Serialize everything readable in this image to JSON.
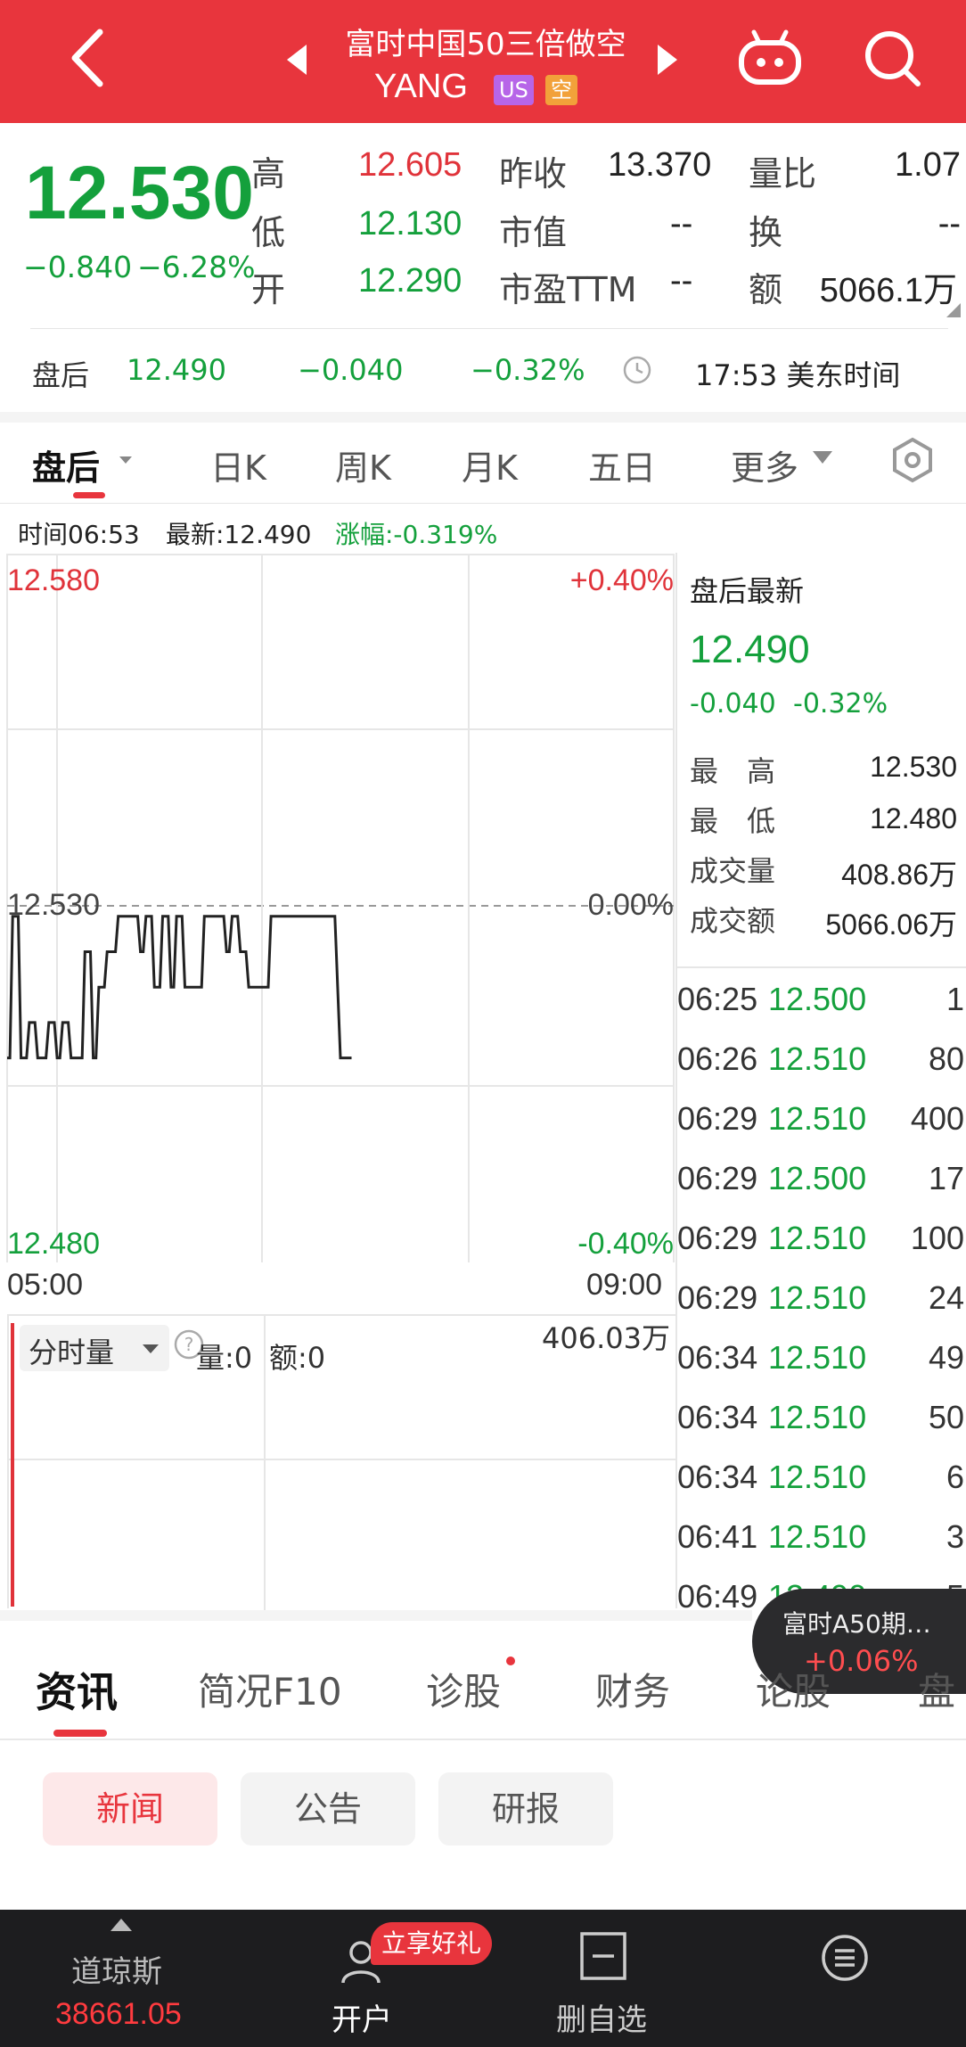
{
  "header": {
    "title": "富时中国50三倍做空",
    "code": "YANG",
    "market_badge": "US",
    "type_badge": "空"
  },
  "quote": {
    "price": "12.530",
    "change": "−0.840",
    "change_pct": "−6.28%",
    "high_label": "高",
    "high": "12.605",
    "low_label": "低",
    "low": "12.130",
    "open_label": "开",
    "open": "12.290",
    "prev_close_label": "昨收",
    "prev_close": "13.370",
    "market_cap_label": "市值",
    "market_cap": "--",
    "pe_label": "市盈TTM",
    "pe": "--",
    "volume_ratio_label": "量比",
    "volume_ratio": "1.07",
    "turnover_label": "换",
    "turnover": "--",
    "amount_label": "额",
    "amount": "5066.1万"
  },
  "after_hours": {
    "label": "盘后",
    "price": "12.490",
    "change": "−0.040",
    "change_pct": "−0.32%",
    "time": "17:53 美东时间"
  },
  "chart_tabs": [
    {
      "label": "盘后"
    },
    {
      "label": "日K"
    },
    {
      "label": "周K"
    },
    {
      "label": "月K"
    },
    {
      "label": "五日"
    },
    {
      "label": "更多"
    }
  ],
  "crosshair": {
    "time": "时间06:53",
    "latest": "最新:12.490",
    "change": "涨幅:-0.319%"
  },
  "chart_axes": {
    "top_price": "12.580",
    "mid_price": "12.530",
    "bottom_price": "12.480",
    "top_pct": "+0.40%",
    "mid_pct": "0.00%",
    "bottom_pct": "-0.40%",
    "x_start": "05:00",
    "x_end": "09:00"
  },
  "side_panel": {
    "title": "盘后最新",
    "price": "12.490",
    "change": "-0.040",
    "change_pct": "-0.32%",
    "high_label": "最　高",
    "high": "12.530",
    "low_label": "最　低",
    "low": "12.480",
    "volume_label": "成交量",
    "volume": "408.86万",
    "amount_label": "成交额",
    "amount": "5066.06万"
  },
  "trades": [
    {
      "time": "06:25",
      "price": "12.500",
      "vol": "1"
    },
    {
      "time": "06:26",
      "price": "12.510",
      "vol": "80"
    },
    {
      "time": "06:29",
      "price": "12.510",
      "vol": "400"
    },
    {
      "time": "06:29",
      "price": "12.500",
      "vol": "17"
    },
    {
      "time": "06:29",
      "price": "12.510",
      "vol": "100"
    },
    {
      "time": "06:29",
      "price": "12.510",
      "vol": "24"
    },
    {
      "time": "06:34",
      "price": "12.510",
      "vol": "49"
    },
    {
      "time": "06:34",
      "price": "12.510",
      "vol": "50"
    },
    {
      "time": "06:34",
      "price": "12.510",
      "vol": "6"
    },
    {
      "time": "06:41",
      "price": "12.510",
      "vol": "3"
    },
    {
      "time": "06:49",
      "price": "12.490",
      "vol": "5"
    }
  ],
  "volume_panel": {
    "selector": "分时量",
    "vol": "量:0",
    "amount": "额:0",
    "max": "406.03万"
  },
  "float_widget": {
    "name": "富时A50期…",
    "change": "+0.06%"
  },
  "content_tabs": [
    {
      "label": "资讯"
    },
    {
      "label": "简况F10"
    },
    {
      "label": "诊股"
    },
    {
      "label": "财务"
    },
    {
      "label": "论股"
    },
    {
      "label": "盘"
    }
  ],
  "segments": [
    {
      "label": "新闻"
    },
    {
      "label": "公告"
    },
    {
      "label": "研报"
    }
  ],
  "bottom_bar": {
    "index_name": "道琼斯",
    "index_value": "38661.05",
    "open_account": "开户",
    "promo": "立享好礼",
    "remove_watch": "删自选"
  },
  "price_series": {
    "ylim": [
      12.48,
      12.58
    ],
    "xlim": [
      0,
      240
    ],
    "points": [
      [
        0,
        12.49
      ],
      [
        1,
        12.49
      ],
      [
        2,
        12.51
      ],
      [
        4,
        12.51
      ],
      [
        5,
        12.49
      ],
      [
        7,
        12.49
      ],
      [
        8,
        12.495
      ],
      [
        10,
        12.495
      ],
      [
        11,
        12.49
      ],
      [
        14,
        12.49
      ],
      [
        15,
        12.495
      ],
      [
        17,
        12.495
      ],
      [
        18,
        12.49
      ],
      [
        19,
        12.49
      ],
      [
        20,
        12.495
      ],
      [
        22,
        12.495
      ],
      [
        23,
        12.49
      ],
      [
        27,
        12.49
      ],
      [
        28,
        12.505
      ],
      [
        30,
        12.505
      ],
      [
        31,
        12.49
      ],
      [
        32,
        12.49
      ],
      [
        33,
        12.5
      ],
      [
        35,
        12.5
      ],
      [
        36,
        12.505
      ],
      [
        39,
        12.505
      ],
      [
        40,
        12.51
      ],
      [
        47,
        12.51
      ],
      [
        48,
        12.505
      ],
      [
        49,
        12.505
      ],
      [
        50,
        12.51
      ],
      [
        52,
        12.51
      ],
      [
        53,
        12.5
      ],
      [
        55,
        12.5
      ],
      [
        56,
        12.51
      ],
      [
        58,
        12.51
      ],
      [
        59,
        12.5
      ],
      [
        60,
        12.5
      ],
      [
        61,
        12.51
      ],
      [
        63,
        12.51
      ],
      [
        64,
        12.5
      ],
      [
        70,
        12.5
      ],
      [
        71,
        12.51
      ],
      [
        78,
        12.51
      ],
      [
        79,
        12.505
      ],
      [
        80,
        12.505
      ],
      [
        81,
        12.51
      ],
      [
        83,
        12.51
      ],
      [
        84,
        12.505
      ],
      [
        86,
        12.505
      ],
      [
        87,
        12.5
      ],
      [
        94,
        12.5
      ],
      [
        95,
        12.51
      ],
      [
        118,
        12.51
      ],
      [
        120,
        12.49
      ],
      [
        124,
        12.49
      ]
    ]
  },
  "colors": {
    "header_red": "#e8353d",
    "down_green": "#14a03c",
    "up_red": "#e0333a"
  }
}
